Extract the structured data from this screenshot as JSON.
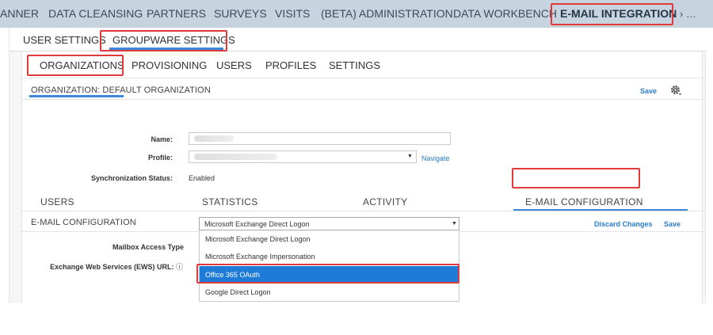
{
  "topnav": {
    "items": [
      "ANNER",
      "DATA CLEANSING",
      "PARTNERS",
      "SURVEYS",
      "VISITS",
      "(BETA) ADMINISTRATION",
      "DATA WORKBENCH",
      "E-MAIL INTEGRATION"
    ],
    "arrows": "‹ › …"
  },
  "subtabs": [
    "USER SETTINGS",
    "GROUPWARE SETTINGS"
  ],
  "card_tabs": [
    "ORGANIZATIONS",
    "PROVISIONING",
    "USERS",
    "PROFILES",
    "SETTINGS"
  ],
  "organization": {
    "title": "ORGANIZATION: DEFAULT ORGANIZATION",
    "save_label": "Save",
    "name_label": "Name:",
    "profile_label": "Profile:",
    "navigate_label": "Navigate",
    "sync_label": "Synchronization Status:",
    "sync_value": "Enabled"
  },
  "detail_tabs": [
    "USERS",
    "STATISTICS",
    "ACTIVITY",
    "E-MAIL CONFIGURATION"
  ],
  "email_config": {
    "title": "E-MAIL CONFIGURATION",
    "discard_label": "Discard Changes",
    "save_label": "Save",
    "mailbox_label": "Mailbox Access Type",
    "mailbox_value": "Microsoft Exchange Direct Logon",
    "ews_label": "Exchange Web Services (EWS) URL:",
    "info_glyph": "ⓘ",
    "options": [
      "Microsoft Exchange Direct Logon",
      "Microsoft Exchange Impersonation",
      "Office 365 OAuth",
      "Google Direct Logon"
    ]
  },
  "colors": {
    "accent": "#3b89d8",
    "highlight": "#e03a3a",
    "selected": "#1f7bd8",
    "nav_bg": "#c7d4e0"
  }
}
